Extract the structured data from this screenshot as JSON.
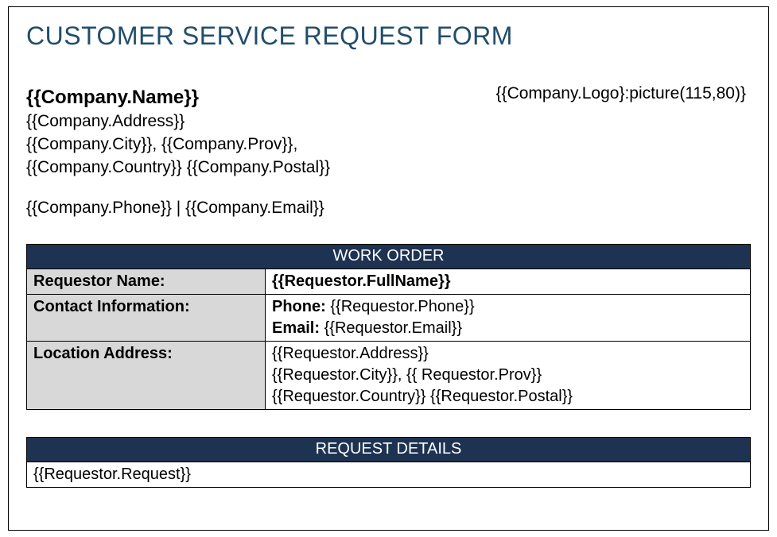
{
  "title": "CUSTOMER SERVICE REQUEST FORM",
  "company": {
    "name": "{{Company.Name}}",
    "address": "{{Company.Address}}",
    "city": "{{Company.City}}",
    "prov": "{{Company.Prov}}",
    "country": "{{Company.Country}}",
    "postal": "{{Company.Postal}}",
    "phone": "{{Company.Phone}}",
    "email": "{{Company.Email}}",
    "logo": "{{Company.Logo}:picture(115,80)}"
  },
  "sections": {
    "work_order": {
      "heading": "WORK ORDER",
      "rows": {
        "requestor_name": {
          "label": "Requestor Name:",
          "value": "{{Requestor.FullName}}"
        },
        "contact_info": {
          "label": "Contact Information:",
          "phone_label": "Phone: ",
          "phone_value": "{{Requestor.Phone}}",
          "email_label": "Email: ",
          "email_value": "{{Requestor.Email}}"
        },
        "location": {
          "label": "Location Address:",
          "address": "{{Requestor.Address}}",
          "city": "{{Requestor.City}}",
          "prov": "{{ Requestor.Prov}}",
          "country": "{{Requestor.Country}}",
          "postal": "{{Requestor.Postal}}"
        }
      }
    },
    "request_details": {
      "heading": "REQUEST DETAILS",
      "value": "{{Requestor.Request}}"
    }
  },
  "separators": {
    "comma": ", ",
    "pipe": "  |  ",
    "space": "  "
  }
}
